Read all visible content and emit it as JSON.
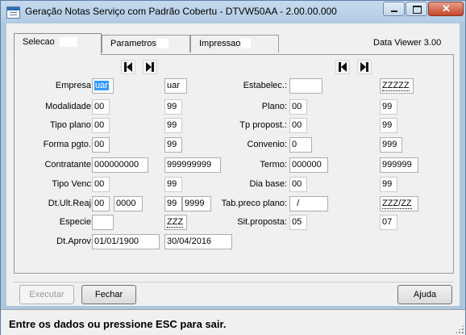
{
  "window": {
    "title": "Geração Notas Serviço com Padrão Cobertu - DTVW50AA - 2.00.00.000",
    "controls": {
      "minimize": "–",
      "maximize": "□",
      "close": "✕"
    }
  },
  "tabs": [
    {
      "label": "Selecao",
      "active": true
    },
    {
      "label": "Parametros",
      "active": false
    },
    {
      "label": "Impressao",
      "active": false
    }
  ],
  "data_viewer": "Data Viewer 3.00",
  "nav_icons": [
    "first-record-icon",
    "last-record-icon"
  ],
  "left_fields": [
    {
      "label": "Empresa:",
      "from": "uar",
      "to": "uar"
    },
    {
      "label": "Modalidade:",
      "from": "00",
      "to": "99"
    },
    {
      "label": "Tipo plano:",
      "from": "00",
      "to": "99"
    },
    {
      "label": "Forma pgto.:",
      "from": "00",
      "to": "99"
    },
    {
      "label": "Contratante:",
      "from": "000000000",
      "to": "999999999"
    },
    {
      "label": "Tipo Venc:",
      "from": "00",
      "to": "99"
    },
    {
      "label": "Dt.Ult.Reaj:",
      "from": "00",
      "from2": "0000",
      "to": "99",
      "to2": "9999"
    },
    {
      "label": "Especie:",
      "from": "",
      "to": "ZZZ"
    },
    {
      "label": "Dt.Aprov:",
      "from": "01/01/1900",
      "to": "30/04/2016"
    }
  ],
  "right_fields": [
    {
      "label": "Estabelec.:",
      "from": "",
      "to": "ZZZZZ"
    },
    {
      "label": "Plano:",
      "from": "00",
      "to": "99"
    },
    {
      "label": "Tp propost.:",
      "from": "00",
      "to": "99"
    },
    {
      "label": "Convenio:",
      "from": "0",
      "to": "999"
    },
    {
      "label": "Termo:",
      "from": "000000",
      "to": "999999"
    },
    {
      "label": "Dia base:",
      "from": "00",
      "to": "99"
    },
    {
      "label": "Tab.preco plano:",
      "from": "  /",
      "to": "ZZZ/ZZ"
    },
    {
      "label": "Sit.proposta:",
      "from": "05",
      "to": "07"
    }
  ],
  "buttons": {
    "execute": "Executar",
    "close": "Fechar",
    "help": "Ajuda"
  },
  "status": "Entre os dados ou pressione ESC para sair."
}
